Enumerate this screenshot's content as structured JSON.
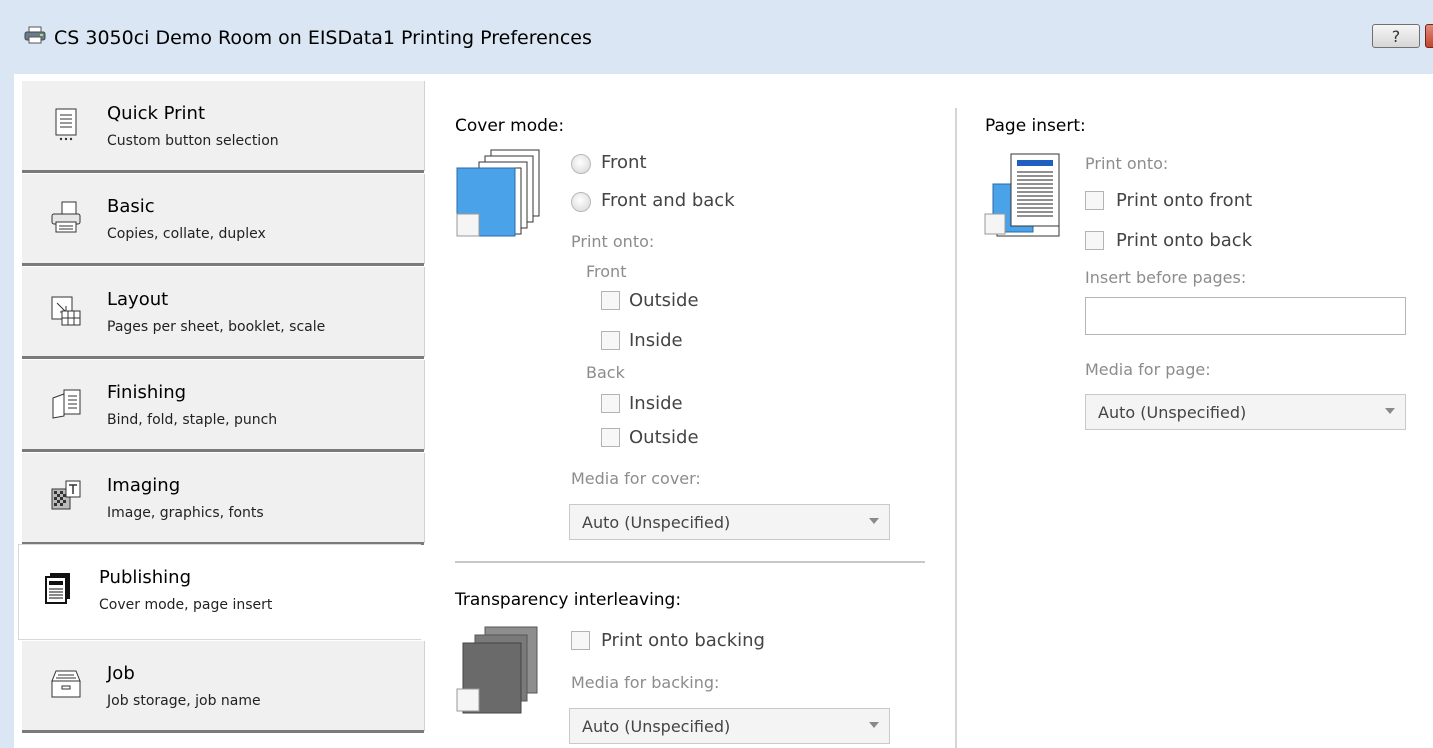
{
  "window": {
    "title": "CS 3050ci Demo Room on EISData1 Printing Preferences",
    "help_label": "?",
    "printer_icon": "printer-icon"
  },
  "tabs": [
    {
      "name": "Quick Print",
      "desc": "Custom button selection",
      "icon": "quick-print-icon"
    },
    {
      "name": "Basic",
      "desc": "Copies, collate, duplex",
      "icon": "basic-icon"
    },
    {
      "name": "Layout",
      "desc": "Pages per sheet, booklet, scale",
      "icon": "layout-icon"
    },
    {
      "name": "Finishing",
      "desc": "Bind, fold, staple, punch",
      "icon": "finishing-icon"
    },
    {
      "name": "Imaging",
      "desc": "Image, graphics, fonts",
      "icon": "imaging-icon"
    },
    {
      "name": "Publishing",
      "desc": "Cover mode, page insert",
      "icon": "publishing-icon",
      "active": true
    },
    {
      "name": "Job",
      "desc": "Job storage, job name",
      "icon": "job-icon"
    }
  ],
  "cover": {
    "heading": "Cover mode:",
    "front": "Front",
    "front_back": "Front and back",
    "print_onto": "Print onto:",
    "front_group": "Front",
    "outside": "Outside",
    "inside": "Inside",
    "back_group": "Back",
    "back_inside": "Inside",
    "back_outside": "Outside",
    "media_label": "Media for cover:",
    "media_value": "Auto (Unspecified)"
  },
  "transparency": {
    "heading": "Transparency interleaving:",
    "print_backing": "Print onto backing",
    "media_label": "Media for backing:",
    "media_value": "Auto (Unspecified)"
  },
  "insert": {
    "heading": "Page insert:",
    "print_onto": "Print onto:",
    "onto_front": "Print onto front",
    "onto_back": "Print onto back",
    "before_label": "Insert before pages:",
    "before_value": "",
    "media_label": "Media for page:",
    "media_value": "Auto (Unspecified)"
  },
  "colors": {
    "titlebar": "#dbe6f4",
    "tab_bg": "#f0f0f0",
    "accent_blue": "#4a9de0",
    "disabled_text": "#8c8c8c"
  }
}
